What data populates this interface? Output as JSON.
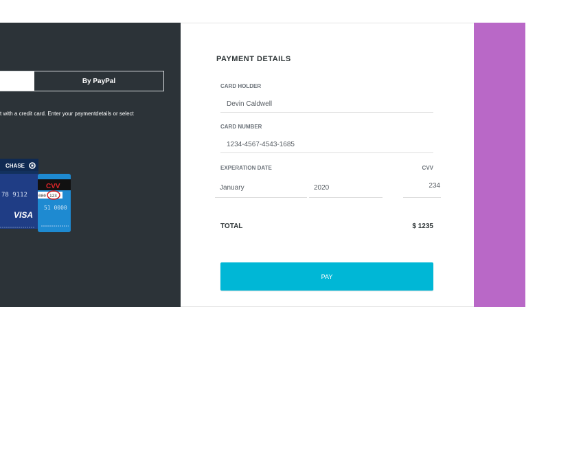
{
  "left": {
    "tab_paypal": "By PayPal",
    "description": "t with a credit card. Enter your paymentdetails or select",
    "card_back_brand": "CHASE",
    "card_front_number": "78 9112",
    "card_front_brand": "VISA",
    "cvv_label": "CVV",
    "cvv_code": "123",
    "card_stripe_left": "000",
    "card_number_tail": "51 0000"
  },
  "form": {
    "title": "PAYMENT DETAILS",
    "card_holder_label": "CARD HOLDER",
    "card_holder_value": "Devin Caldwell",
    "card_number_label": "CARD NUMBER",
    "card_number_value": "1234-4567-4543-1685",
    "expiration_label": "EXPERATION DATE",
    "cvv_label": "CVV",
    "month_value": "January",
    "year_value": "2020",
    "cvv_value": "234",
    "total_label": "TOTAL",
    "total_value": "$ 1235",
    "pay_label": "PAY"
  },
  "colors": {
    "left_bg": "#2c3338",
    "accent_purple": "#b968c7",
    "pay_button": "#00b7d6"
  }
}
